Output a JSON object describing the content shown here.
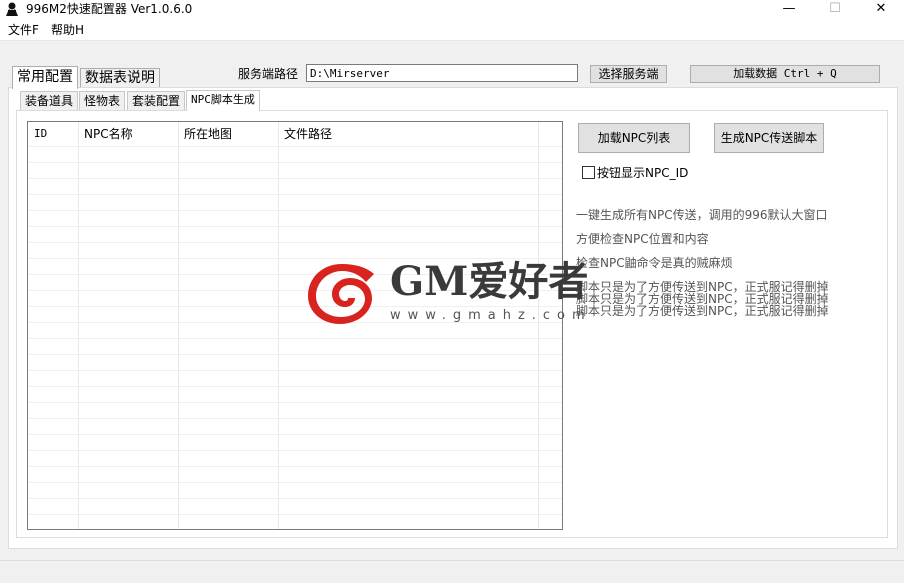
{
  "window": {
    "title": "996M2快速配置器 Ver1.0.6.0",
    "minimize": "—",
    "maximize": "☐",
    "close": "✕"
  },
  "menu": [
    "文件F",
    "帮助H"
  ],
  "outer_tabs": [
    "常用配置",
    "数据表说明"
  ],
  "server": {
    "path_label": "服务端路径",
    "path_value": "D:\\Mirserver",
    "choose_button": "选择服务端",
    "load_button": "加载数据 Ctrl + Q"
  },
  "inner_tabs": [
    "装备道具",
    "怪物表",
    "套装配置",
    "NPC脚本生成"
  ],
  "table": {
    "columns": [
      "ID",
      "NPC名称",
      "所在地图",
      "文件路径"
    ],
    "rows": []
  },
  "actions": {
    "load_npc_list": "加载NPC列表",
    "generate_script": "生成NPC传送脚本",
    "show_npc_id": "按钮显示NPC_ID",
    "show_npc_id_checked": false
  },
  "info": [
    "一键生成所有NPC传送，调用的996默认大窗口",
    "方便检查NPC位置和内容",
    "检查NPC鼬命令是真的贼麻烦",
    "脚本只是为了方便传送到NPC，正式服记得删掉",
    "脚本只是为了方便传送到NPC，正式服记得删掉",
    "脚本只是为了方便传送到NPC，正式服记得删掉"
  ],
  "watermark": {
    "brand": "GM爱好者",
    "url": "www.gmahz.com",
    "logo_color": "#d9231f"
  }
}
